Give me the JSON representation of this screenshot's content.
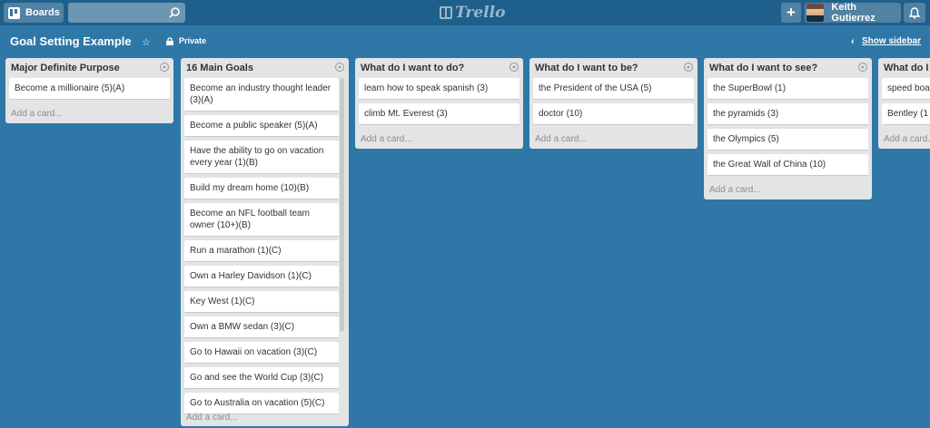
{
  "header": {
    "boards_label": "Boards",
    "search_value": "",
    "logo_text": "Trello",
    "user_name": "Keith Gutierrez",
    "add_symbol": "+"
  },
  "board": {
    "title": "Goal Setting Example",
    "visibility": "Private",
    "show_sidebar": "Show sidebar"
  },
  "add_card_label": "Add a card...",
  "lists": [
    {
      "title": "Major Definite Purpose",
      "cards": [
        "Become a millionaire (5)(A)"
      ]
    },
    {
      "title": "16 Main Goals",
      "cards": [
        "Become an industry thought leader (3)(A)",
        "Become a public speaker (5)(A)",
        "Have the ability to go on vacation every year (1)(B)",
        "Build my dream home (10)(B)",
        "Become an NFL football team owner (10+)(B)",
        "Run a marathon (1)(C)",
        "Own a Harley Davidson (1)(C)",
        "Key West (1)(C)",
        "Own a BMW sedan (3)(C)",
        "Go to Hawaii on vacation (3)(C)",
        "Go and see the World Cup (3)(C)",
        "Go to Australia on vacation (5)(C)"
      ]
    },
    {
      "title": "What do I want to do?",
      "cards": [
        "learn how to speak spanish (3)",
        "climb Mt. Everest (3)"
      ]
    },
    {
      "title": "What do I want to be?",
      "cards": [
        "the President of the USA (5)",
        "doctor (10)"
      ]
    },
    {
      "title": "What do I want to see?",
      "cards": [
        "the SuperBowl (1)",
        "the pyramids (3)",
        "the Olympics (5)",
        "the Great Wall of China (10)"
      ]
    },
    {
      "title": "What do I",
      "cards": [
        "speed boa",
        "Bentley (1"
      ]
    }
  ],
  "colors": {
    "board_bg": "#2e77a7",
    "header_bg": "#1f5f8b",
    "list_bg": "#e2e4e6"
  }
}
